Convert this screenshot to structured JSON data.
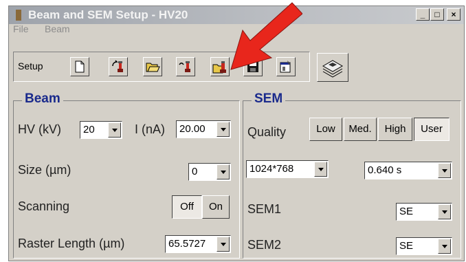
{
  "window": {
    "title": "Beam and SEM Setup - HV20"
  },
  "menu": [
    "File",
    "Beam"
  ],
  "toolbar": {
    "label": "Setup",
    "buttons": [
      "new-file-icon",
      "load-beam-icon",
      "open-folder-icon",
      "save-beam-icon",
      "open-sem-icon",
      "save-disk-icon",
      "properties-icon"
    ],
    "big_button": "image-stack-icon"
  },
  "beam": {
    "title": "Beam",
    "hv_label": "HV (kV)",
    "hv_value": "20",
    "i_label": "I (nA)",
    "i_value": "20.00",
    "size_label": "Size (µm)",
    "size_value": "0",
    "scanning_label": "Scanning",
    "scanning_off": "Off",
    "scanning_on": "On",
    "raster_label": "Raster Length (µm)",
    "raster_value": "65.5727"
  },
  "sem": {
    "title": "SEM",
    "quality_label": "Quality",
    "quality_options": [
      "Low",
      "Med.",
      "High",
      "User"
    ],
    "quality_selected": "User",
    "resolution_value": "1024*768",
    "time_value": "0.640 s",
    "sem1_label": "SEM1",
    "sem1_value": "SE",
    "sem2_label": "SEM2",
    "sem2_value": "SE"
  },
  "colors": {
    "arrow": "#e8261c",
    "group_title": "#1a2a8c",
    "face": "#d4d0c8"
  }
}
